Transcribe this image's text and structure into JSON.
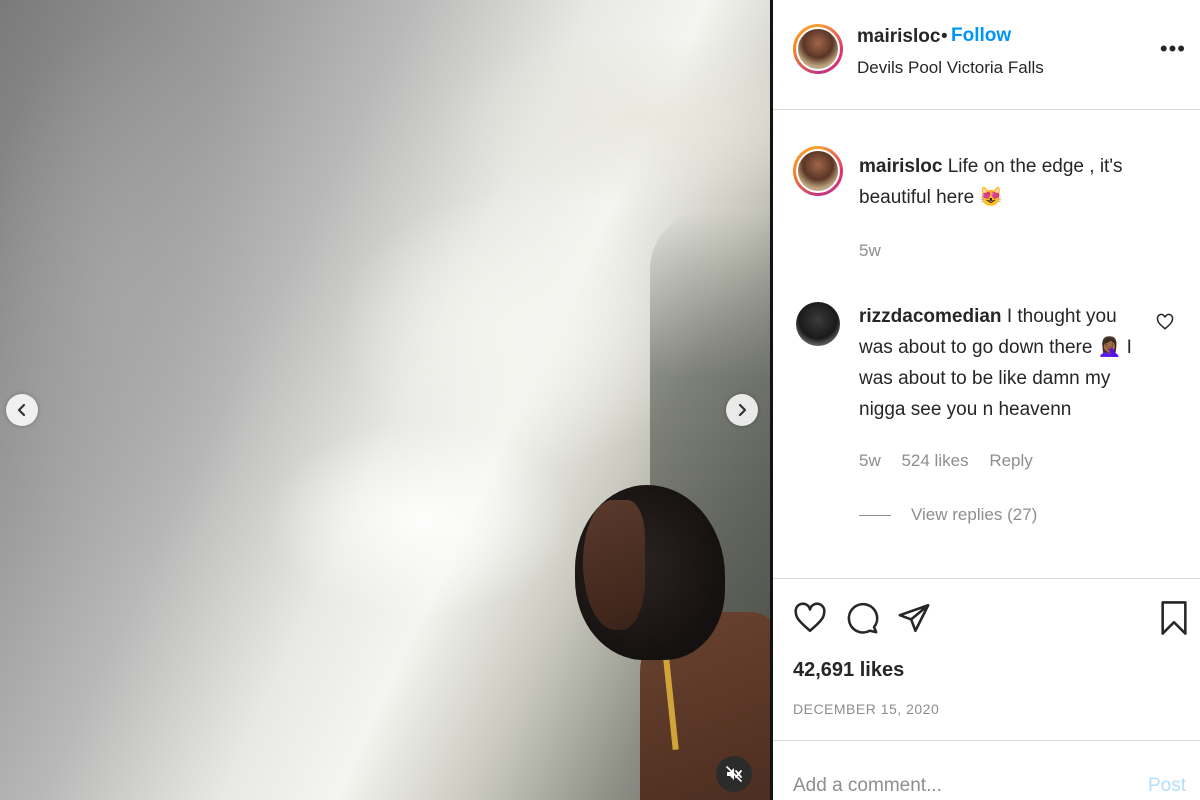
{
  "post": {
    "username": "mairisloc",
    "separator": "•",
    "follow_label": "Follow",
    "location": "Devils Pool Victoria Falls",
    "more_label": "•••"
  },
  "caption": {
    "username": "mairisloc",
    "text": "Life on the edge , it's",
    "text_line2": "beautiful here 😻",
    "time": "5w"
  },
  "comments": [
    {
      "username": "rizzdacomedian",
      "line1": "I thought you",
      "line2": "was about to go down there 🤦🏾‍♀️ I",
      "line3": "was about to be like damn my",
      "line4": "nigga see you n heavenn",
      "time": "5w",
      "likes": "524 likes",
      "reply_label": "Reply",
      "view_replies": "View replies (27)"
    }
  ],
  "actions": {
    "likes": "42,691 likes",
    "date": "DECEMBER 15, 2020"
  },
  "add_comment": {
    "placeholder": "Add a comment...",
    "post_label": "Post"
  },
  "icons": [
    "chevron-left-icon",
    "chevron-right-icon",
    "mute-icon",
    "more-icon",
    "heart-icon",
    "comment-icon",
    "share-icon",
    "bookmark-icon"
  ],
  "colors": {
    "follow": "#0095f6",
    "post_disabled": "#b2dffc",
    "muted_text": "#8e8e8e"
  }
}
